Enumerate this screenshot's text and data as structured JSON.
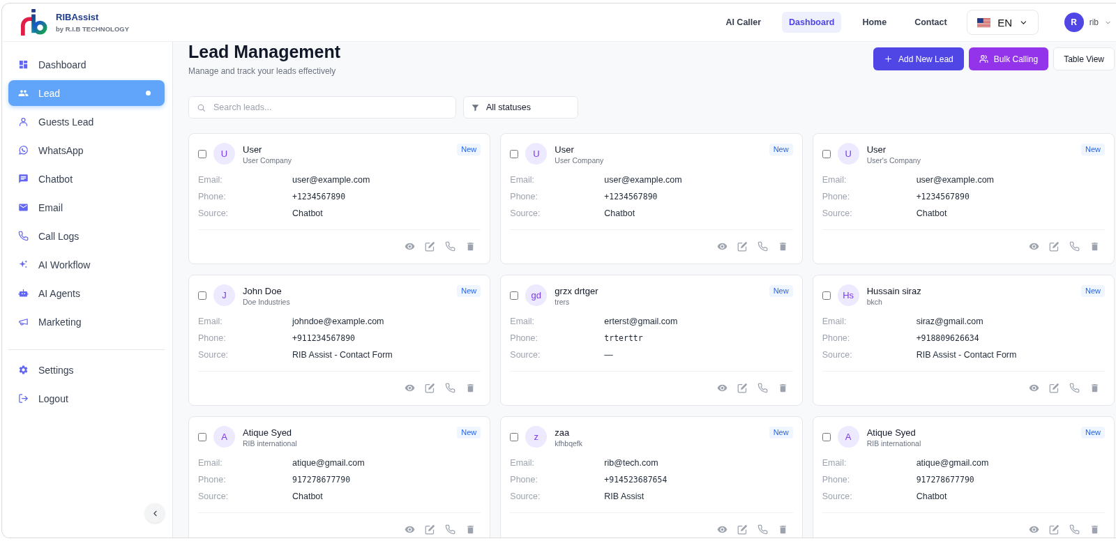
{
  "header": {
    "brand": {
      "name": "RIBAssist",
      "tagline": "by R.I.B TECHNOLOGY"
    },
    "nav": [
      {
        "label": "AI Caller",
        "selected": false
      },
      {
        "label": "Dashboard",
        "selected": true
      },
      {
        "label": "Home",
        "selected": false
      },
      {
        "label": "Contact",
        "selected": false
      }
    ],
    "language": {
      "code": "EN"
    },
    "user": {
      "initial": "R",
      "name": "rib"
    }
  },
  "sidebar": {
    "items": [
      {
        "label": "Dashboard",
        "selected": false
      },
      {
        "label": "Lead",
        "selected": true
      },
      {
        "label": "Guests Lead",
        "selected": false
      },
      {
        "label": "WhatsApp",
        "selected": false
      },
      {
        "label": "Chatbot",
        "selected": false
      },
      {
        "label": "Email",
        "selected": false
      },
      {
        "label": "Call Logs",
        "selected": false
      },
      {
        "label": "AI Workflow",
        "selected": false
      },
      {
        "label": "AI Agents",
        "selected": false
      },
      {
        "label": "Marketing",
        "selected": false
      }
    ],
    "bottom_items": [
      {
        "label": "Settings",
        "selected": false
      },
      {
        "label": "Logout",
        "selected": false
      }
    ]
  },
  "page": {
    "title": "Lead Management",
    "subtitle": "Manage and track your leads effectively",
    "actions": [
      {
        "label": "Add New Lead",
        "kind": "primary"
      },
      {
        "label": "Bulk Calling",
        "kind": "accent"
      },
      {
        "label": "Table View",
        "kind": "outline"
      }
    ],
    "search": {
      "placeholder": "Search leads..."
    },
    "status_filter": {
      "value": "All statuses"
    }
  },
  "leads": [
    {
      "initials": "U",
      "name": "User",
      "company": "User Company",
      "status": "New",
      "checked": false,
      "fields": [
        {
          "kind": "email",
          "label": "Email:",
          "value": "user@example.com"
        },
        {
          "kind": "phone",
          "label": "Phone:",
          "value": "+1234567890"
        },
        {
          "kind": "source",
          "label": "Source:",
          "value": "Chatbot"
        }
      ]
    },
    {
      "initials": "U",
      "name": "User",
      "company": "User Company",
      "status": "New",
      "checked": false,
      "fields": [
        {
          "kind": "email",
          "label": "Email:",
          "value": "user@example.com"
        },
        {
          "kind": "phone",
          "label": "Phone:",
          "value": "+1234567890"
        },
        {
          "kind": "source",
          "label": "Source:",
          "value": "Chatbot"
        }
      ]
    },
    {
      "initials": "U",
      "name": "User",
      "company": "User's Company",
      "status": "New",
      "checked": false,
      "fields": [
        {
          "kind": "email",
          "label": "Email:",
          "value": "user@example.com"
        },
        {
          "kind": "phone",
          "label": "Phone:",
          "value": "+1234567890"
        },
        {
          "kind": "source",
          "label": "Source:",
          "value": "Chatbot"
        }
      ]
    },
    {
      "initials": "J",
      "name": "John Doe",
      "company": "Doe Industries",
      "status": "New",
      "checked": false,
      "fields": [
        {
          "kind": "email",
          "label": "Email:",
          "value": "johndoe@example.com"
        },
        {
          "kind": "phone",
          "label": "Phone:",
          "value": "+911234567890"
        },
        {
          "kind": "source",
          "label": "Source:",
          "value": "RIB Assist - Contact Form"
        }
      ]
    },
    {
      "initials": "gd",
      "name": "grzx drtger",
      "company": "trers",
      "status": "New",
      "checked": false,
      "fields": [
        {
          "kind": "email",
          "label": "Email:",
          "value": "erterst@gmail.com"
        },
        {
          "kind": "phone",
          "label": "Phone:",
          "value": "trterttr"
        },
        {
          "kind": "source",
          "label": "Source:",
          "value": "—"
        }
      ]
    },
    {
      "initials": "Hs",
      "name": "Hussain siraz",
      "company": "bkch",
      "status": "New",
      "checked": false,
      "fields": [
        {
          "kind": "email",
          "label": "Email:",
          "value": "siraz@gmail.com"
        },
        {
          "kind": "phone",
          "label": "Phone:",
          "value": "+918809626634"
        },
        {
          "kind": "source",
          "label": "Source:",
          "value": "RIB Assist - Contact Form"
        }
      ]
    },
    {
      "initials": "A",
      "name": "Atique Syed",
      "company": "RIB international",
      "status": "New",
      "checked": false,
      "fields": [
        {
          "kind": "email",
          "label": "Email:",
          "value": "atique@gmail.com"
        },
        {
          "kind": "phone",
          "label": "Phone:",
          "value": "917278677790"
        },
        {
          "kind": "source",
          "label": "Source:",
          "value": "Chatbot"
        }
      ]
    },
    {
      "initials": "z",
      "name": "zaa",
      "company": "kfhbqefk",
      "status": "New",
      "checked": false,
      "fields": [
        {
          "kind": "email",
          "label": "Email:",
          "value": "rib@tech.com"
        },
        {
          "kind": "phone",
          "label": "Phone:",
          "value": "+914523687654"
        },
        {
          "kind": "source",
          "label": "Source:",
          "value": "RIB Assist"
        }
      ]
    },
    {
      "initials": "A",
      "name": "Atique Syed",
      "company": "RIB international",
      "status": "New",
      "checked": false,
      "fields": [
        {
          "kind": "email",
          "label": "Email:",
          "value": "atique@gmail.com"
        },
        {
          "kind": "phone",
          "label": "Phone:",
          "value": "917278677790"
        },
        {
          "kind": "source",
          "label": "Source:",
          "value": "Chatbot"
        }
      ]
    }
  ]
}
